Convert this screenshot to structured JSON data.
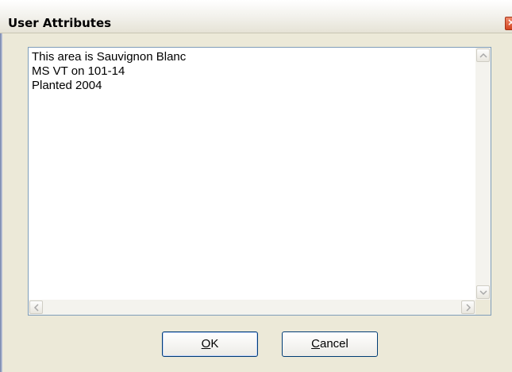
{
  "window": {
    "title": "User Attributes",
    "close_glyph": "×"
  },
  "attributes_text": "This area is Sauvignon Blanc\nMS VT on 101-14\nPlanted 2004",
  "buttons": {
    "ok_label": "OK",
    "cancel_label": "Cancel"
  },
  "icons": {
    "close": "close-icon",
    "scroll_up": "arrow-up-icon",
    "scroll_down": "arrow-down-icon",
    "scroll_left": "arrow-left-icon",
    "scroll_right": "arrow-right-icon"
  },
  "colors": {
    "dialog_bg": "#ece9d8",
    "close_button": "#d2441f",
    "button_border": "#003c74",
    "textarea_border": "#7f9db9"
  }
}
